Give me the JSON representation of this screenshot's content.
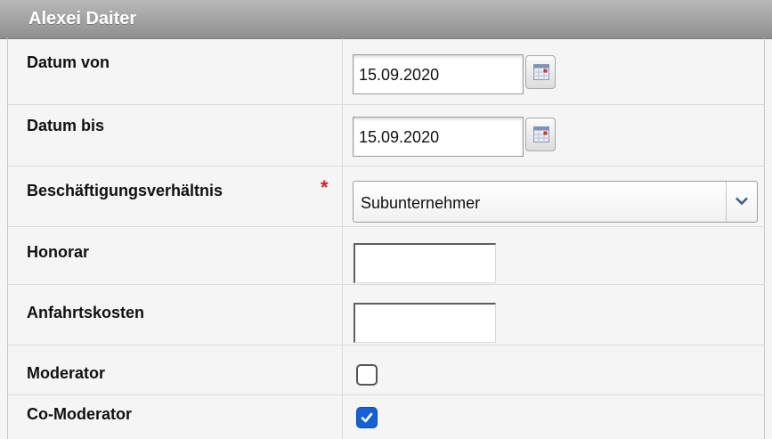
{
  "header": {
    "title": "Alexei Daiter"
  },
  "fields": {
    "datum_von": {
      "label": "Datum von",
      "value": "15.09.2020",
      "icon": "calendar-icon"
    },
    "datum_bis": {
      "label": "Datum bis",
      "value": "15.09.2020",
      "icon": "calendar-icon"
    },
    "beschaeftigung": {
      "label": "Beschäftigungsverhältnis",
      "required_mark": "*",
      "selected": "Subunternehmer",
      "icon": "chevron-down-icon"
    },
    "honorar": {
      "label": "Honorar",
      "value": ""
    },
    "anfahrtskosten": {
      "label": "Anfahrtskosten",
      "value": ""
    },
    "moderator": {
      "label": "Moderator",
      "checked": false
    },
    "co_moderator": {
      "label": "Co-Moderator",
      "checked": true
    }
  },
  "colors": {
    "header_bg": "#9e9e9e",
    "required": "#d22222",
    "checkbox_checked": "#1560d8"
  }
}
